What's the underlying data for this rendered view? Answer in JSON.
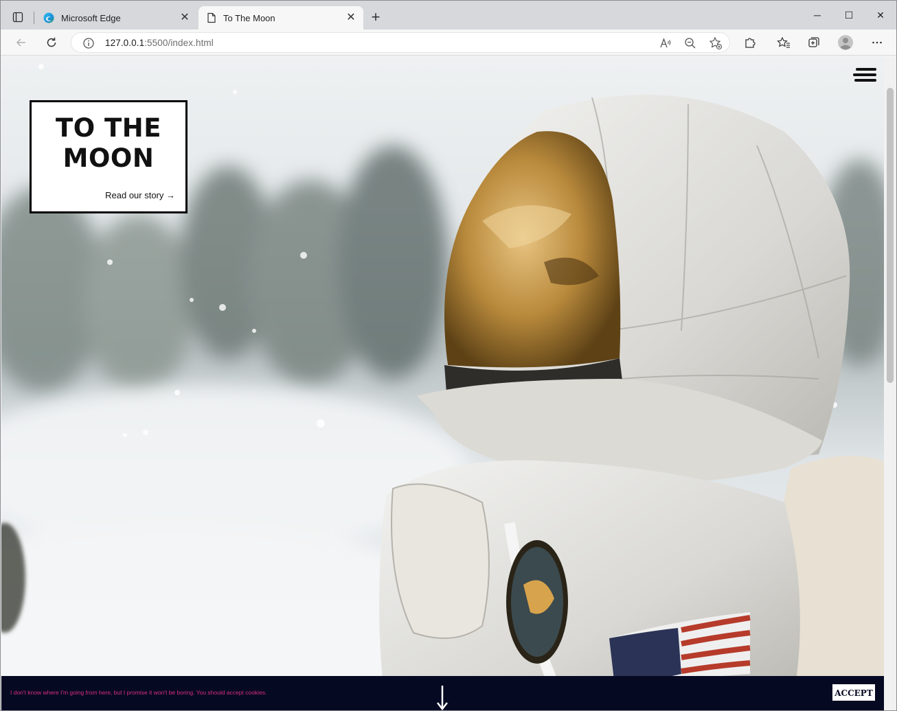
{
  "browser": {
    "tabs": [
      {
        "title": "Microsoft Edge",
        "active": false,
        "icon": "edge-logo-icon"
      },
      {
        "title": "To The Moon",
        "active": true,
        "icon": "page-icon"
      }
    ],
    "tab_close_glyph": "✕",
    "new_tab_glyph": "+",
    "address": {
      "host": "127.0.0.1",
      "rest": ":5500/index.html"
    },
    "window_controls": {
      "minimize": "─",
      "maximize": "☐",
      "close": "✕"
    }
  },
  "page": {
    "title_line1": "TO THE",
    "title_line2": "MOON",
    "story_link": "Read our story →",
    "cookie_message": "I don't know where I'm going from here, but I promise it won't be boring. You should accept cookies.",
    "accept_label": "ACCEPT"
  },
  "colors": {
    "cookie_bg": "#060922",
    "cookie_text": "#d6307d",
    "card_border": "#000000"
  }
}
